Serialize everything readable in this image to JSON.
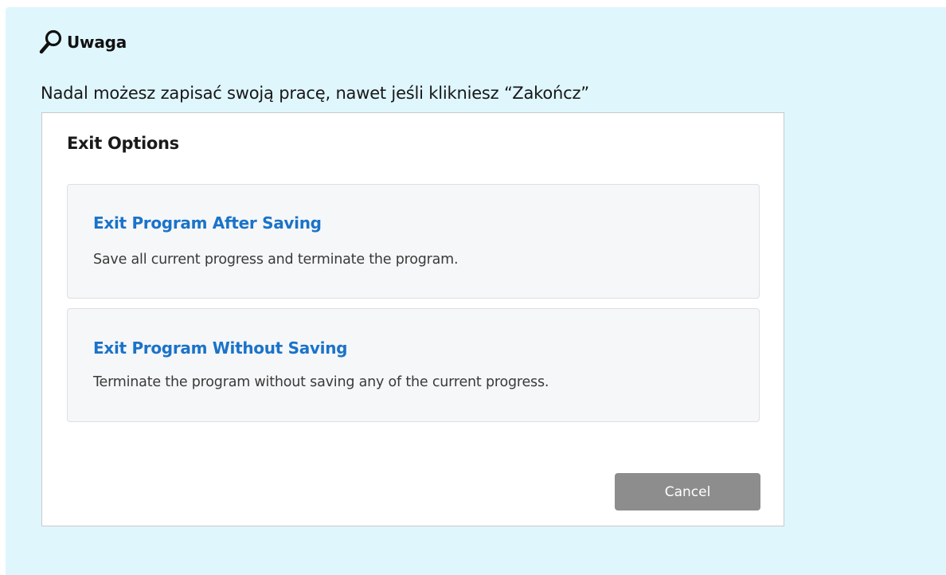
{
  "callout": {
    "icon": "magnifier-icon",
    "title": "Uwaga",
    "text": "Nadal możesz zapisać swoją pracę, nawet jeśli klikniesz “Zakończ”",
    "background": "#dff6fd"
  },
  "dialog": {
    "title": "Exit Options",
    "options": [
      {
        "title": "Exit Program After Saving",
        "description": "Save all current progress and terminate the program."
      },
      {
        "title": "Exit Program Without Saving",
        "description": "Terminate the program without saving any of the current progress."
      }
    ],
    "cancel_label": "Cancel",
    "colors": {
      "option_title": "#1a73c9",
      "cancel_button": "#8d8d8d"
    }
  }
}
